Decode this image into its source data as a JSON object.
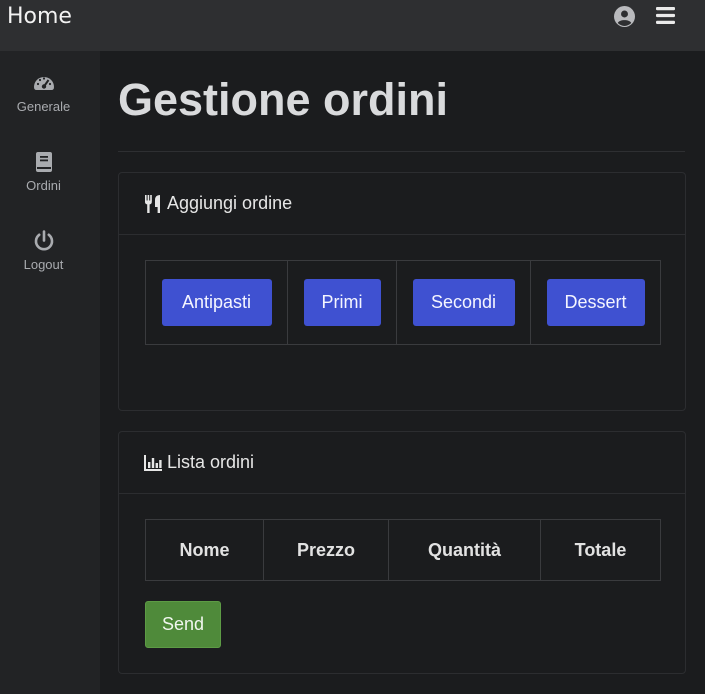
{
  "header": {
    "brand": "Home"
  },
  "sidebar": {
    "items": [
      {
        "label": "Generale",
        "icon": "gauge-icon"
      },
      {
        "label": "Ordini",
        "icon": "book-icon"
      },
      {
        "label": "Logout",
        "icon": "power-icon"
      }
    ]
  },
  "main": {
    "title": "Gestione ordini",
    "add_card": {
      "header": "Aggiungi ordine",
      "icon": "utensils-icon",
      "categories": [
        "Antipasti",
        "Primi",
        "Secondi",
        "Dessert"
      ]
    },
    "list_card": {
      "header": "Lista ordini",
      "icon": "chart-bar-icon",
      "columns": [
        "Nome",
        "Prezzo",
        "Quantità",
        "Totale"
      ],
      "send_label": "Send"
    }
  },
  "colors": {
    "primary_button": "#3f51d1",
    "success_button": "#4f8a3a",
    "background": "#1b1c1e",
    "topbar": "#2e2f31",
    "sidebar": "#222325"
  }
}
